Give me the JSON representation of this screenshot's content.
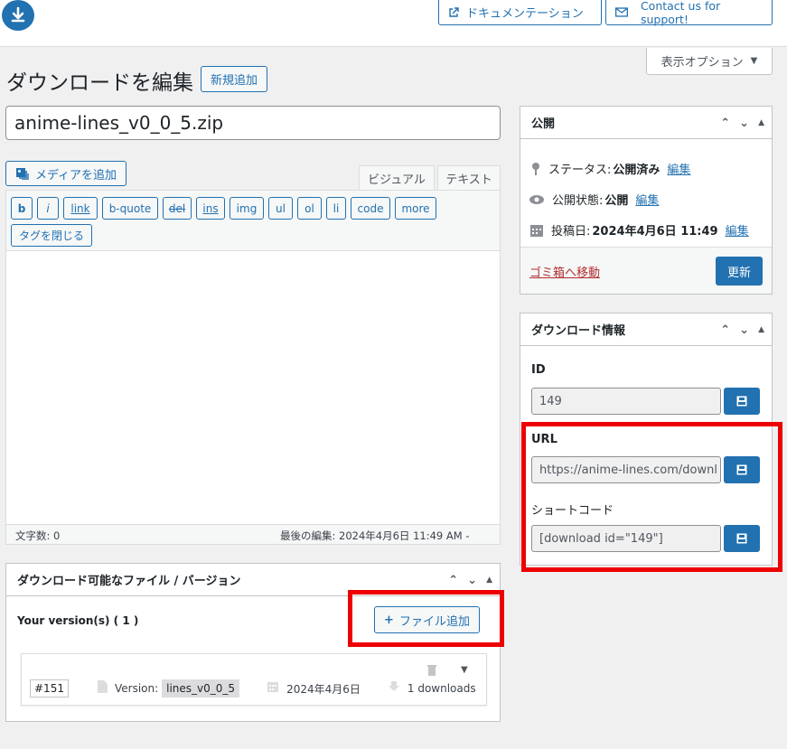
{
  "topbar": {
    "docs_label": "ドキュメンテーション",
    "support_label": "Contact us for support!",
    "screen_options_label": "表示オプション"
  },
  "page": {
    "title": "ダウンロードを編集",
    "add_new_label": "新規追加",
    "post_title": "anime-lines_v0_0_5.zip"
  },
  "editor": {
    "add_media_label": "メディアを追加",
    "tab_visual": "ビジュアル",
    "tab_text": "テキスト",
    "quicktags": [
      "b",
      "i",
      "link",
      "b-quote",
      "del",
      "ins",
      "img",
      "ul",
      "ol",
      "li",
      "code",
      "more"
    ],
    "close_tags_label": "タグを閉じる",
    "word_count": "文字数: 0",
    "last_edited": "最後の編集: 2024年4月6日 11:49 AM -"
  },
  "publish": {
    "title": "公開",
    "status_label": "ステータス:",
    "status_value": "公開済み",
    "visibility_label": "公開状態:",
    "visibility_value": "公開",
    "date_label": "投稿日:",
    "date_value": "2024年4月6日 11:49",
    "edit_label": "編集",
    "trash_label": "ゴミ箱へ移動",
    "update_label": "更新"
  },
  "download_info": {
    "title": "ダウンロード情報",
    "id_label": "ID",
    "id_value": "149",
    "url_label": "URL",
    "url_value": "https://anime-lines.com/downl",
    "shortcode_label": "ショートコード",
    "shortcode_value": "[download id=\"149\"]"
  },
  "files": {
    "title": "ダウンロード可能なファイル / バージョン",
    "versions_label": "Your version(s) ( 1 )",
    "add_file_label": "ファイル追加",
    "version": {
      "id": "#151",
      "version_label": "Version:",
      "version_value": "lines_v0_0_5",
      "date": "2024年4月6日",
      "downloads": "1 downloads"
    }
  },
  "colors": {
    "accent": "#2271b1",
    "highlight": "#ee0000"
  }
}
